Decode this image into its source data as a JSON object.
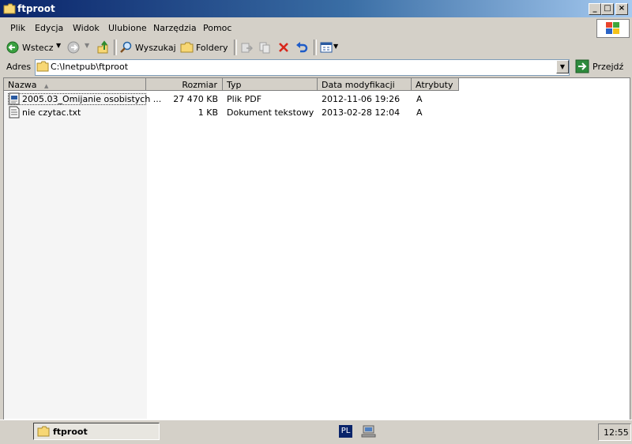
{
  "window": {
    "title": "ftproot",
    "buttons": {
      "minimize": "_",
      "maximize": "□",
      "close": "×"
    }
  },
  "menu": {
    "items": [
      "Plik",
      "Edycja",
      "Widok",
      "Ulubione",
      "Narzędzia",
      "Pomoc"
    ]
  },
  "toolbar": {
    "back_label": "Wstecz",
    "search_label": "Wyszukaj",
    "folders_label": "Foldery"
  },
  "address": {
    "label": "Adres",
    "value": "C:\\Inetpub\\ftproot",
    "go_label": "Przejdź"
  },
  "columns": {
    "name": "Nazwa",
    "size": "Rozmiar",
    "type": "Typ",
    "modified": "Data modyfikacji",
    "attributes": "Atrybuty"
  },
  "files": [
    {
      "name": "2005.03_Omijanie osobistych ...",
      "size": "27 470 KB",
      "type": "Plik PDF",
      "modified": "2012-11-06 19:26",
      "attributes": "A",
      "icon": "pdf-file-icon"
    },
    {
      "name": "nie czytac.txt",
      "size": "1 KB",
      "type": "Dokument tekstowy",
      "modified": "2013-02-28 12:04",
      "attributes": "A",
      "icon": "text-file-icon"
    }
  ],
  "taskbar": {
    "task_label": "ftproot",
    "language": "PL",
    "clock": "12:55"
  },
  "colors": {
    "title_gradient_start": "#0a246a",
    "title_gradient_end": "#a6caf0",
    "face": "#d4d0c8",
    "go_green": "#2d8a3c"
  }
}
